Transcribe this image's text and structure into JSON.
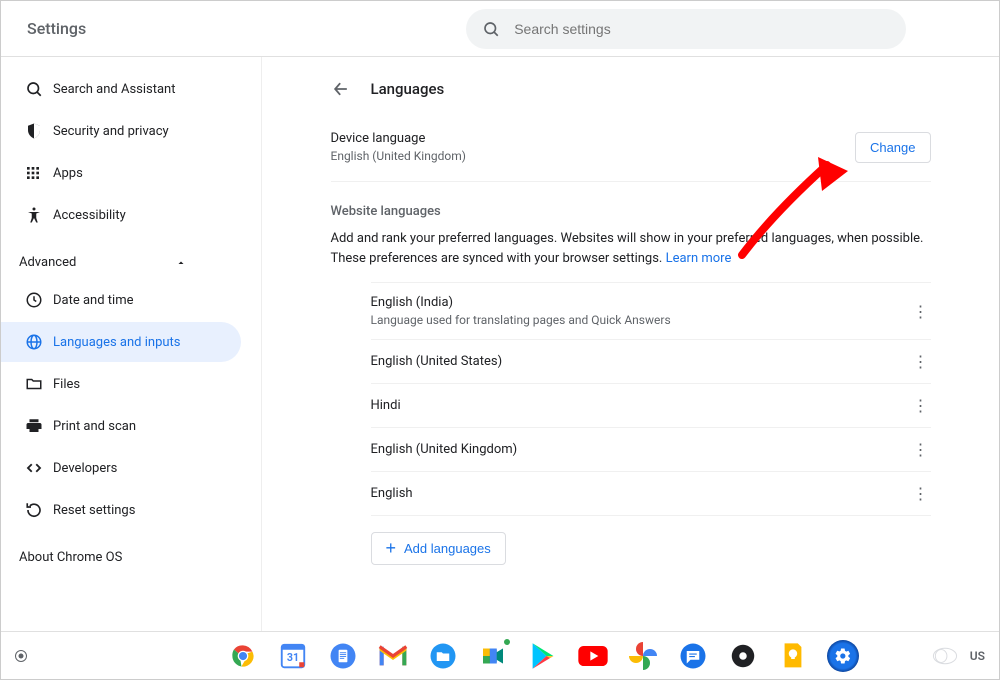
{
  "header": {
    "title": "Settings",
    "search_placeholder": "Search settings"
  },
  "sidebar": {
    "items_top": [
      {
        "label": "Search and Assistant",
        "icon": "search"
      },
      {
        "label": "Security and privacy",
        "icon": "shield"
      },
      {
        "label": "Apps",
        "icon": "apps"
      },
      {
        "label": "Accessibility",
        "icon": "accessibility"
      }
    ],
    "advanced_label": "Advanced",
    "items_adv": [
      {
        "label": "Date and time",
        "icon": "clock"
      },
      {
        "label": "Languages and inputs",
        "icon": "globe"
      },
      {
        "label": "Files",
        "icon": "folder"
      },
      {
        "label": "Print and scan",
        "icon": "printer"
      },
      {
        "label": "Developers",
        "icon": "code"
      },
      {
        "label": "Reset settings",
        "icon": "reset"
      }
    ],
    "about_label": "About Chrome OS"
  },
  "main": {
    "page_title": "Languages",
    "device_language": {
      "label": "Device language",
      "value": "English (United Kingdom)",
      "change_btn": "Change"
    },
    "website_languages": {
      "heading": "Website languages",
      "desc": "Add and rank your preferred languages. Websites will show in your preferred languages, when possible. These preferences are synced with your browser settings. ",
      "learn_more": "Learn more",
      "languages": [
        {
          "name": "English (India)",
          "note": "Language used for translating pages and Quick Answers"
        },
        {
          "name": "English (United States)",
          "note": ""
        },
        {
          "name": "Hindi",
          "note": ""
        },
        {
          "name": "English (United Kingdom)",
          "note": ""
        },
        {
          "name": "English",
          "note": ""
        }
      ],
      "add_btn": "Add languages"
    }
  },
  "shelf": {
    "ime": "US",
    "apps": [
      "chrome",
      "calendar",
      "docs",
      "gmail",
      "files",
      "meet",
      "play",
      "youtube",
      "photos",
      "messages",
      "assistant",
      "keep",
      "settings"
    ]
  },
  "colors": {
    "accent": "#1a73e8",
    "arrow": "#ff0000"
  }
}
